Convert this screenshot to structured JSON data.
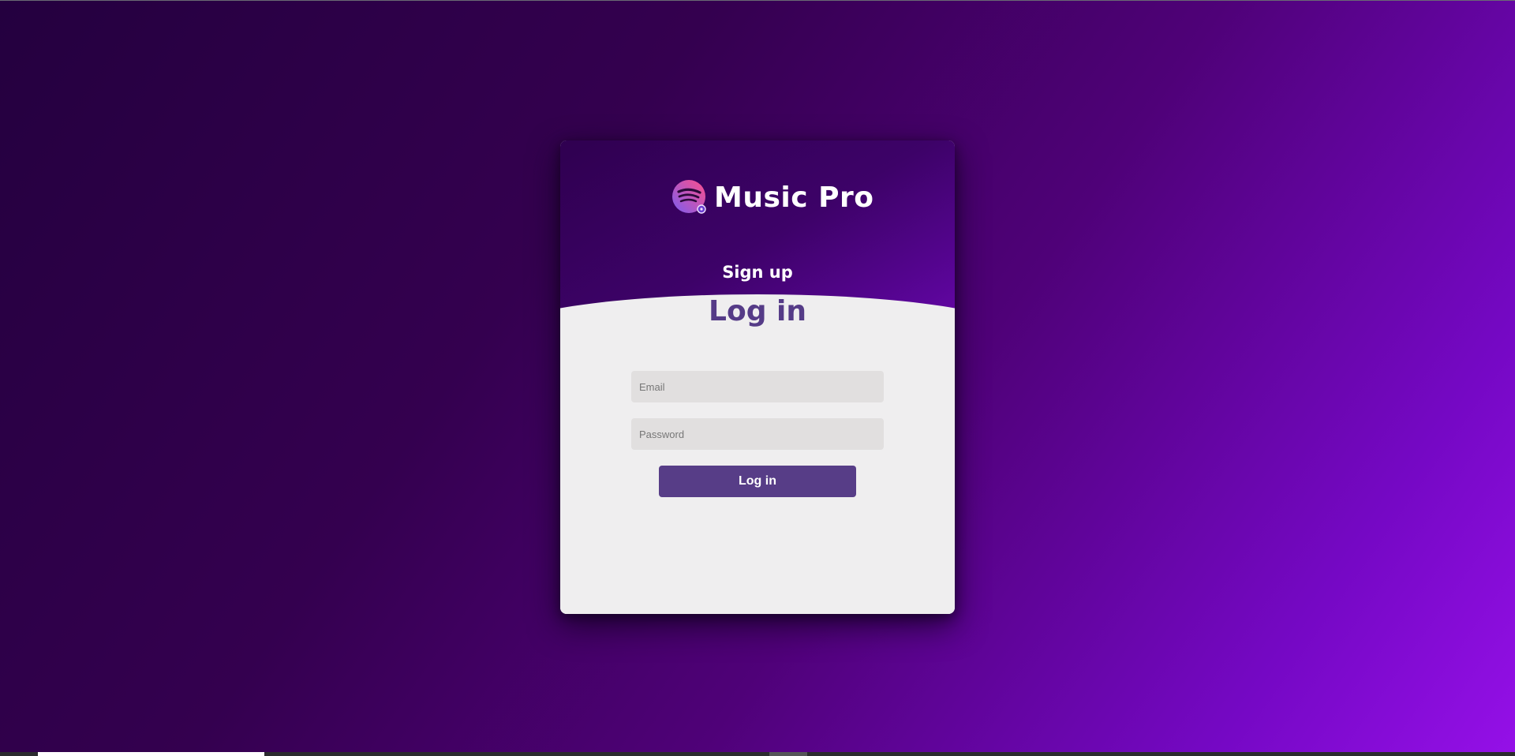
{
  "app": {
    "brand_name": "Music Pro",
    "logo_icon": "music-stream-icon"
  },
  "tabs": {
    "signup_label": "Sign up",
    "login_heading": "Log in"
  },
  "form": {
    "email_placeholder": "Email",
    "email_value": "",
    "password_placeholder": "Password",
    "password_value": "",
    "submit_label": "Log in"
  },
  "colors": {
    "accent": "#553b87",
    "button": "#573d87",
    "card_background": "#efeeef",
    "background_start": "#24003f",
    "background_end": "#9510e8"
  }
}
